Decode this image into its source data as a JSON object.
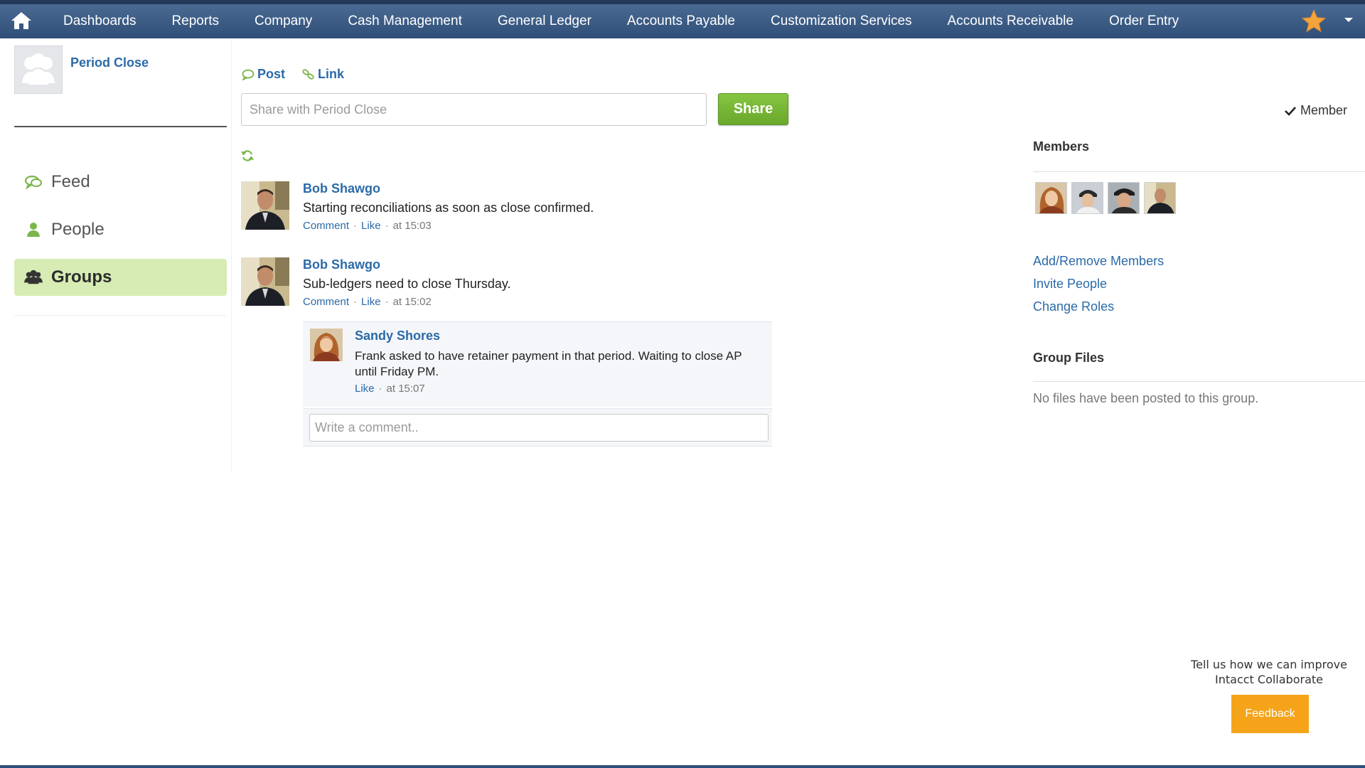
{
  "nav": {
    "items": [
      {
        "label": "Dashboards"
      },
      {
        "label": "Reports"
      },
      {
        "label": "Company"
      },
      {
        "label": "Cash Management"
      },
      {
        "label": "General Ledger"
      },
      {
        "label": "Accounts Payable"
      },
      {
        "label": "Customization Services"
      },
      {
        "label": "Accounts Receivable"
      },
      {
        "label": "Order Entry"
      }
    ]
  },
  "sidebar": {
    "group_name": "Period Close",
    "items": [
      {
        "label": "Feed",
        "icon": "feed-icon"
      },
      {
        "label": "People",
        "icon": "person-icon"
      },
      {
        "label": "Groups",
        "icon": "group-icon",
        "active": true
      }
    ]
  },
  "composer": {
    "post_label": "Post",
    "link_label": "Link",
    "placeholder": "Share with Period Close",
    "share_label": "Share"
  },
  "posts": [
    {
      "author": "Bob Shawgo",
      "text": "Starting reconciliations as soon as close confirmed.",
      "comment_label": "Comment",
      "like_label": "Like",
      "time": "at 15:03"
    },
    {
      "author": "Bob Shawgo",
      "text": "Sub-ledgers need to close Thursday.",
      "comment_label": "Comment",
      "like_label": "Like",
      "time": "at 15:02",
      "comments": [
        {
          "author": "Sandy Shores",
          "text": "Frank asked to have retainer payment in that period. Waiting to close AP until Friday PM.",
          "like_label": "Like",
          "time": "at 15:07"
        }
      ]
    }
  ],
  "write_comment": {
    "placeholder": "Write a comment.."
  },
  "right": {
    "member_status": "Member",
    "members_heading": "Members",
    "links": [
      "Add/Remove Members",
      "Invite People",
      "Change Roles"
    ],
    "files_heading": "Group Files",
    "no_files": "No files have been posted to this group."
  },
  "feedback": {
    "prompt_line1": "Tell us how we can improve",
    "prompt_line2": "Intacct Collaborate",
    "button": "Feedback"
  },
  "colors": {
    "nav": "#2f4f78",
    "link": "#2b6aa8",
    "share_button": "#78b838",
    "active_nav": "#d6ecb4",
    "feedback": "#f5a41a"
  }
}
